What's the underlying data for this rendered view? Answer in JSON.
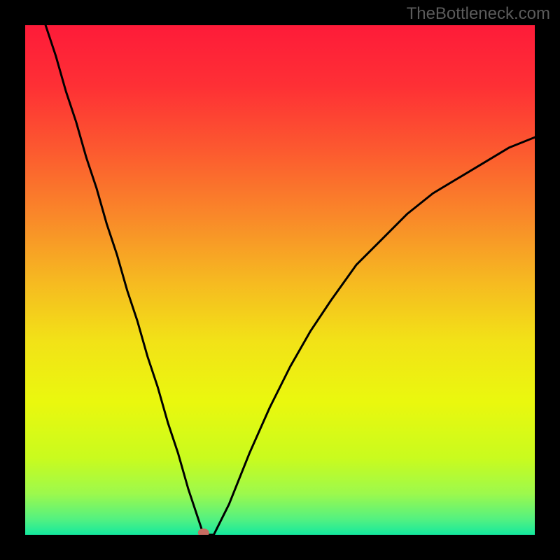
{
  "watermark": "TheBottleneck.com",
  "chart_data": {
    "type": "line",
    "title": "",
    "xlabel": "",
    "ylabel": "",
    "xlim": [
      0,
      100
    ],
    "ylim": [
      0,
      100
    ],
    "marker": {
      "x": 35,
      "y": 0
    },
    "series": [
      {
        "name": "curve",
        "x": [
          4,
          6,
          8,
          10,
          12,
          14,
          16,
          18,
          20,
          22,
          24,
          26,
          28,
          30,
          32,
          33,
          34,
          35,
          36,
          37,
          38,
          40,
          44,
          48,
          52,
          56,
          60,
          65,
          70,
          75,
          80,
          85,
          90,
          95,
          100
        ],
        "y": [
          100,
          94,
          87,
          81,
          74,
          68,
          61,
          55,
          48,
          42,
          35,
          29,
          22,
          16,
          9,
          6,
          3,
          0,
          0,
          0,
          2,
          6,
          16,
          25,
          33,
          40,
          46,
          53,
          58,
          63,
          67,
          70,
          73,
          76,
          78
        ]
      }
    ],
    "background_gradient": {
      "stops": [
        {
          "offset": 0.0,
          "color": "#fe1b39"
        },
        {
          "offset": 0.12,
          "color": "#fe3035"
        },
        {
          "offset": 0.25,
          "color": "#fc5b2f"
        },
        {
          "offset": 0.38,
          "color": "#f98a29"
        },
        {
          "offset": 0.5,
          "color": "#f6b821"
        },
        {
          "offset": 0.62,
          "color": "#f2e217"
        },
        {
          "offset": 0.74,
          "color": "#eaf80e"
        },
        {
          "offset": 0.85,
          "color": "#c9fb1e"
        },
        {
          "offset": 0.92,
          "color": "#9cf94d"
        },
        {
          "offset": 0.97,
          "color": "#52f181"
        },
        {
          "offset": 1.0,
          "color": "#14e99e"
        }
      ]
    }
  }
}
